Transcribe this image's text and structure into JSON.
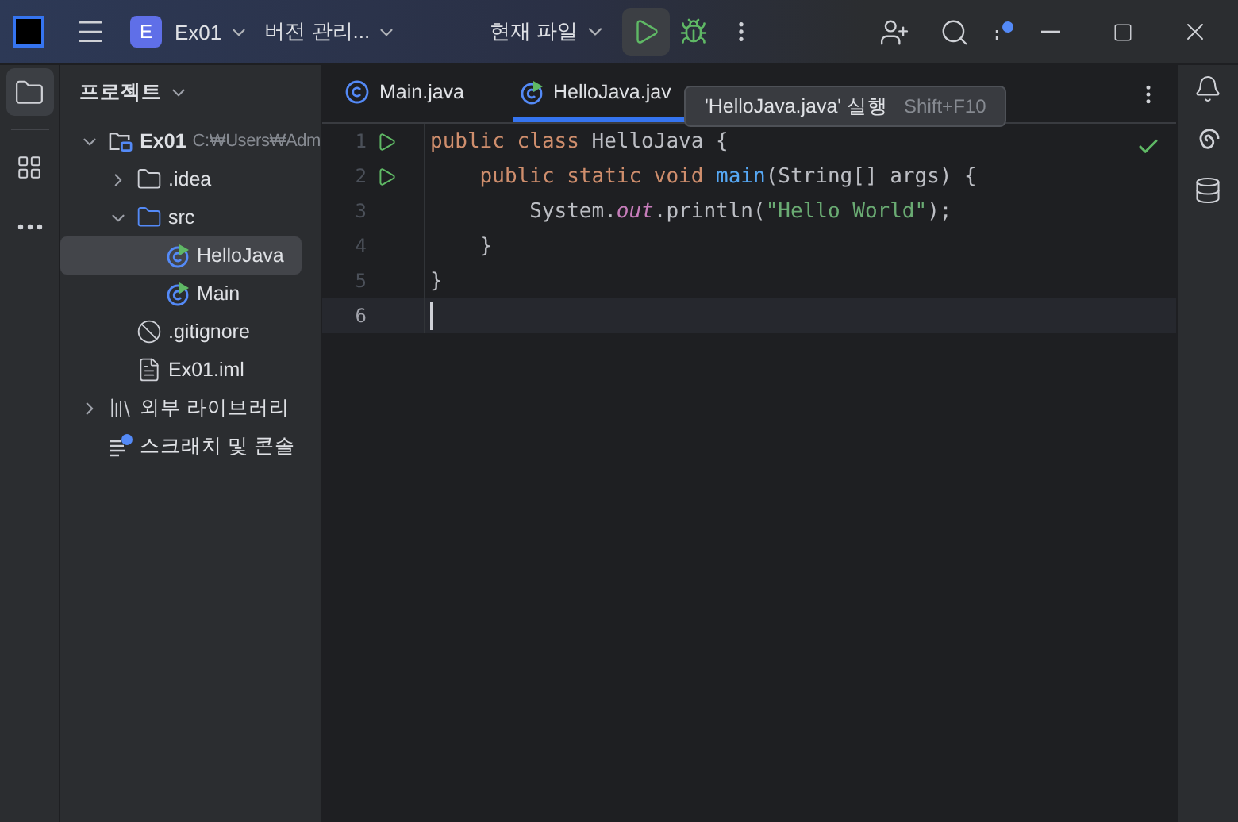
{
  "title_bar": {
    "project_badge": "E",
    "project": "Ex01",
    "vcs": "버전 관리...",
    "run_config": "현재 파일"
  },
  "project_panel": {
    "title": "프로젝트",
    "tree": [
      {
        "label": "Ex01",
        "hint": "C:₩Users₩Adm",
        "kind": "module",
        "expanded": true,
        "selected": false,
        "children": [
          {
            "label": ".idea",
            "kind": "folder",
            "expanded": false,
            "selected": false
          },
          {
            "label": "src",
            "kind": "source",
            "expanded": true,
            "selected": false,
            "children": [
              {
                "label": "HelloJava",
                "kind": "runclass",
                "selected": true
              },
              {
                "label": "Main",
                "kind": "runclass",
                "selected": false
              }
            ]
          },
          {
            "label": ".gitignore",
            "kind": "ignore",
            "selected": false
          },
          {
            "label": "Ex01.iml",
            "kind": "file",
            "selected": false
          }
        ]
      },
      {
        "label": "외부 라이브러리",
        "kind": "library",
        "expanded": false,
        "selected": false
      },
      {
        "label": "스크래치 및 콘솔",
        "kind": "scratch",
        "selected": false
      }
    ]
  },
  "tabs": [
    {
      "label": "Main.java",
      "kind": "class",
      "selected": false
    },
    {
      "label": "HelloJava.jav",
      "kind": "runclass",
      "selected": true
    }
  ],
  "tooltip": {
    "text": "'HelloJava.java' 실행",
    "shortcut": "Shift+F10"
  },
  "editor": {
    "lines": [
      {
        "number": "1",
        "run": true,
        "current": false,
        "tokens": [
          {
            "kind": "keyword",
            "text": "public class "
          },
          {
            "kind": "plain",
            "text": "HelloJava {"
          }
        ]
      },
      {
        "number": "2",
        "run": true,
        "current": false,
        "tokens": [
          {
            "kind": "keyword",
            "text": "    public static void "
          },
          {
            "kind": "method",
            "text": "main"
          },
          {
            "kind": "plain",
            "text": "(String[] args) {"
          }
        ]
      },
      {
        "number": "3",
        "run": false,
        "current": false,
        "tokens": [
          {
            "kind": "plain",
            "text": "        System."
          },
          {
            "kind": "field",
            "text": "out"
          },
          {
            "kind": "plain",
            "text": ".println("
          },
          {
            "kind": "string",
            "text": "\"Hello World\""
          },
          {
            "kind": "plain",
            "text": ");"
          }
        ]
      },
      {
        "number": "4",
        "run": false,
        "current": false,
        "tokens": [
          {
            "kind": "plain",
            "text": "    }"
          }
        ]
      },
      {
        "number": "5",
        "run": false,
        "current": false,
        "tokens": [
          {
            "kind": "plain",
            "text": "}"
          }
        ]
      },
      {
        "number": "6",
        "run": false,
        "current": true
      }
    ]
  }
}
